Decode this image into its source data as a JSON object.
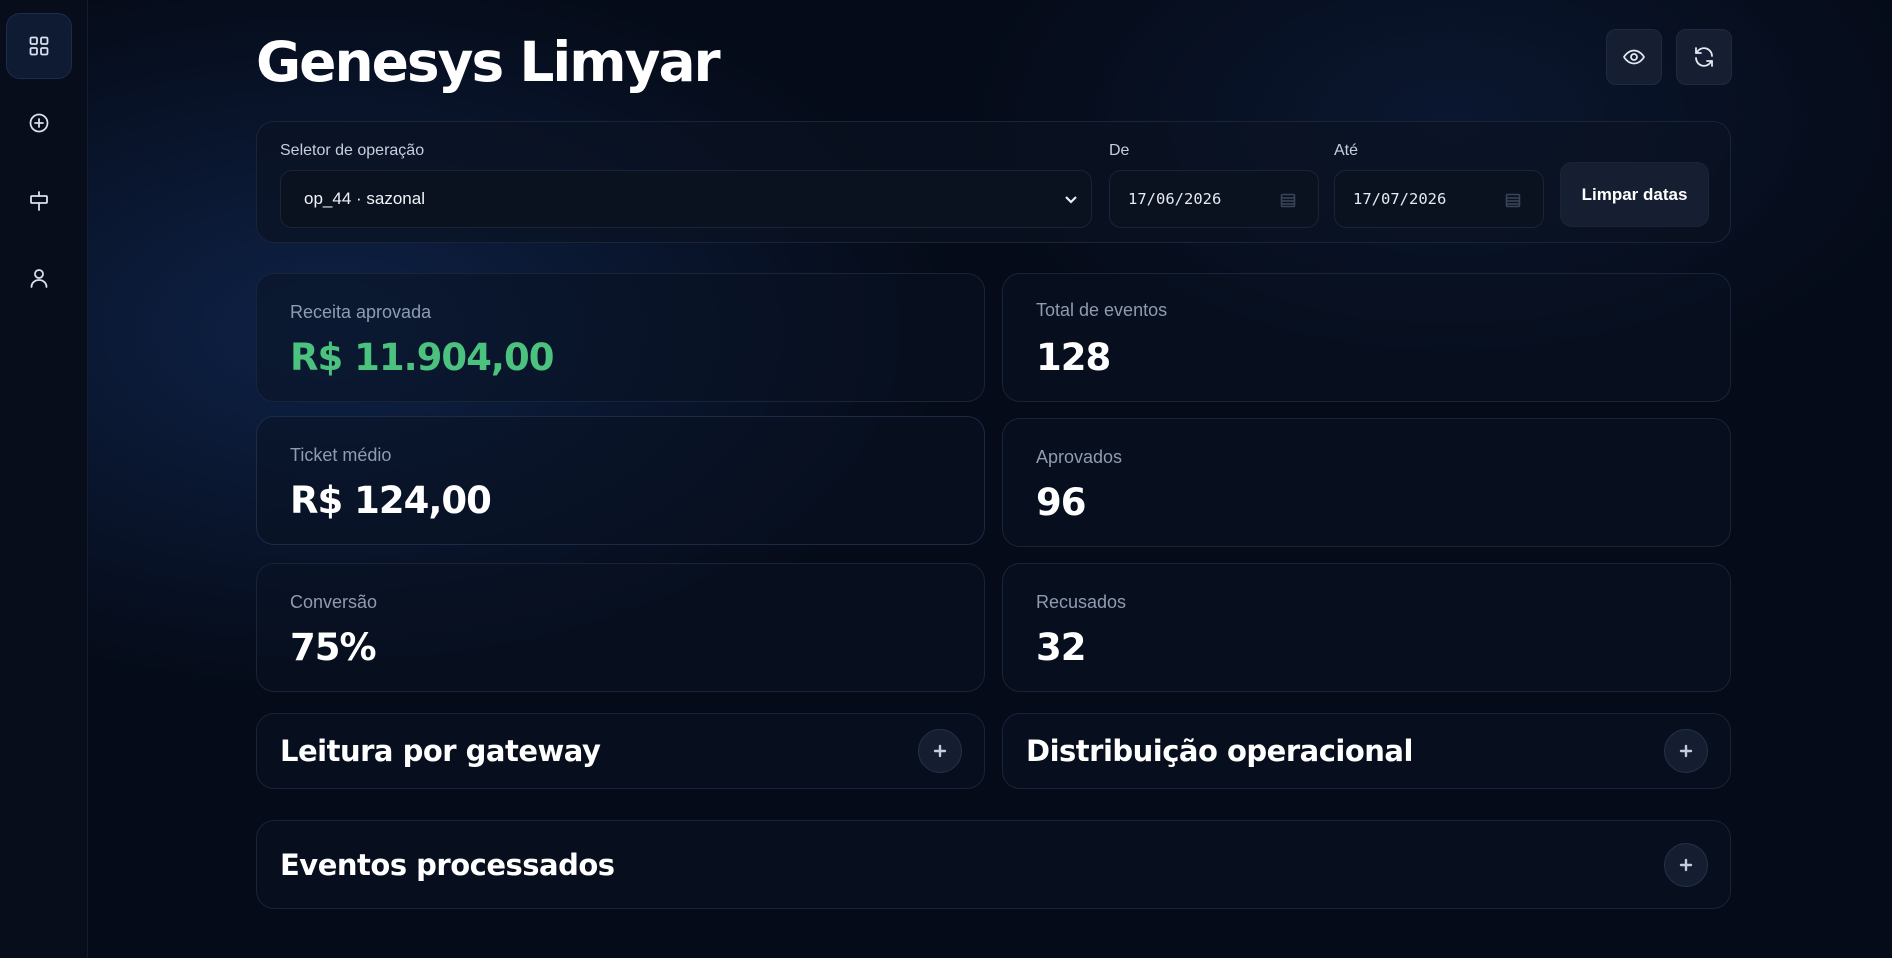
{
  "sidebar": {
    "items": [
      {
        "icon": "dashboard-grid-icon",
        "active": true
      },
      {
        "icon": "plus-circle-icon",
        "active": false
      },
      {
        "icon": "plug-icon",
        "active": false
      },
      {
        "icon": "user-icon",
        "active": false
      }
    ]
  },
  "header": {
    "title": "Genesys Limyar",
    "actions": [
      {
        "icon": "eye-icon"
      },
      {
        "icon": "refresh-icon"
      }
    ]
  },
  "filters": {
    "operation_label": "Seletor de operação",
    "operation_value": "op_44 · sazonal",
    "from_label": "De",
    "from_value": "17/06/2026",
    "to_label": "Até",
    "to_value": "17/07/2026",
    "clear_label": "Limpar datas"
  },
  "stats": [
    {
      "label": "Receita aprovada",
      "value": "R$ 11.904,00",
      "color": "#4cc27f"
    },
    {
      "label": "Total de eventos",
      "value": "128"
    },
    {
      "label": "Ticket médio",
      "value": "R$ 124,00"
    },
    {
      "label": "Aprovados",
      "value": "96"
    },
    {
      "label": "Conversão",
      "value": "75%"
    },
    {
      "label": "Recusados",
      "value": "32"
    }
  ],
  "sections": [
    {
      "title": "Leitura por gateway",
      "expanded": false
    },
    {
      "title": "Distribuição operacional",
      "expanded": false
    },
    {
      "title": "Eventos processados",
      "expanded": false
    }
  ]
}
